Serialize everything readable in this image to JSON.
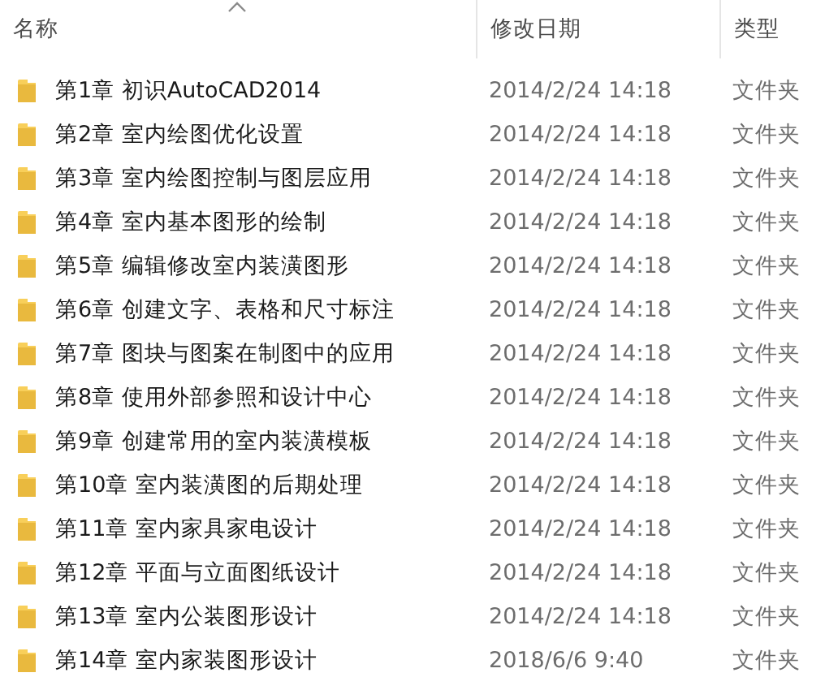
{
  "columns": [
    {
      "label": "名称",
      "sorted": true
    },
    {
      "label": "修改日期",
      "sorted": false
    },
    {
      "label": "类型",
      "sorted": false
    }
  ],
  "rows": [
    {
      "name": "第1章 初识AutoCAD2014",
      "modified": "2014/2/24 14:18",
      "type": "文件夹"
    },
    {
      "name": "第2章 室内绘图优化设置",
      "modified": "2014/2/24 14:18",
      "type": "文件夹"
    },
    {
      "name": "第3章 室内绘图控制与图层应用",
      "modified": "2014/2/24 14:18",
      "type": "文件夹"
    },
    {
      "name": "第4章 室内基本图形的绘制",
      "modified": "2014/2/24 14:18",
      "type": "文件夹"
    },
    {
      "name": "第5章 编辑修改室内装潢图形",
      "modified": "2014/2/24 14:18",
      "type": "文件夹"
    },
    {
      "name": "第6章 创建文字、表格和尺寸标注",
      "modified": "2014/2/24 14:18",
      "type": "文件夹"
    },
    {
      "name": "第7章 图块与图案在制图中的应用",
      "modified": "2014/2/24 14:18",
      "type": "文件夹"
    },
    {
      "name": "第8章 使用外部参照和设计中心",
      "modified": "2014/2/24 14:18",
      "type": "文件夹"
    },
    {
      "name": "第9章 创建常用的室内装潢模板",
      "modified": "2014/2/24 14:18",
      "type": "文件夹"
    },
    {
      "name": "第10章 室内装潢图的后期处理",
      "modified": "2014/2/24 14:18",
      "type": "文件夹"
    },
    {
      "name": "第11章 室内家具家电设计",
      "modified": "2014/2/24 14:18",
      "type": "文件夹"
    },
    {
      "name": "第12章 平面与立面图纸设计",
      "modified": "2014/2/24 14:18",
      "type": "文件夹"
    },
    {
      "name": "第13章 室内公装图形设计",
      "modified": "2014/2/24 14:18",
      "type": "文件夹"
    },
    {
      "name": "第14章 室内家装图形设计",
      "modified": "2018/6/6 9:40",
      "type": "文件夹"
    }
  ]
}
